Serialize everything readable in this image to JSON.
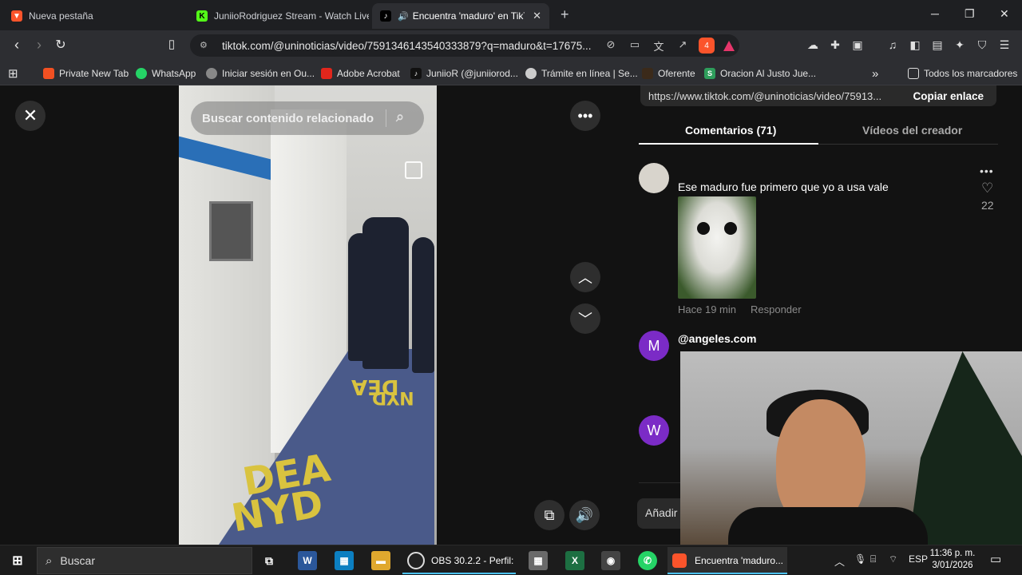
{
  "browser": {
    "tabs": [
      {
        "label": "Nueva pestaña",
        "icon": "brave-lion-icon"
      },
      {
        "label": "JuniioRodriguez Stream - Watch Live",
        "icon": "kick-icon"
      },
      {
        "label": "Encuentra 'maduro' en TikTok",
        "icon": "tiktok-icon",
        "audio": true
      }
    ],
    "window_controls": {
      "minimize": "─",
      "maximize": "❐",
      "close": "✕"
    },
    "new_tab": "+",
    "url": "tiktok.com/@uninoticias/video/7591346143540333879?q=maduro&t=17675...",
    "shields_count": "4"
  },
  "bookmarks": [
    {
      "label": "Private New Tab",
      "color": "#f25022"
    },
    {
      "label": "WhatsApp",
      "color": "#25d366"
    },
    {
      "label": "Iniciar sesión en Ou...",
      "color": "#888888"
    },
    {
      "label": "Adobe Acrobat",
      "color": "#e1261c"
    },
    {
      "label": "JuniioR (@juniiorod...",
      "color": "#111111"
    },
    {
      "label": "Trámite en línea | Se...",
      "color": "#cccccc"
    },
    {
      "label": "Oferente",
      "color": "#3b2a1a"
    },
    {
      "label": "Oracion Al Justo Jue...",
      "color": "#2e9d5b"
    }
  ],
  "bookmarks_more": "»",
  "bookmarks_all": "Todos los marcadores",
  "viewer": {
    "search_placeholder": "Buscar contenido relacionado",
    "video_text_1": "DEA",
    "video_text_2": "NYD",
    "video_text_3": "DEA",
    "video_text_4": "NYD"
  },
  "panel": {
    "share_url": "https://www.tiktok.com/@uninoticias/video/75913...",
    "copy_label": "Copiar enlace",
    "tab_comments": "Comentarios (71)",
    "tab_creator": "Vídeos del creador",
    "comments": [
      {
        "text": "Ese maduro fue primero que yo a usa vale",
        "time": "Hace 19 min",
        "reply": "Responder",
        "likes": "22"
      },
      {
        "user": "@angeles.com",
        "avatar_letter": "M",
        "avatar_color": "#7b2bc6"
      },
      {
        "avatar_letter": "W",
        "avatar_color": "#7b2bc6"
      }
    ],
    "add_comment": "Añadir"
  },
  "taskbar": {
    "search": "Buscar",
    "apps": [
      {
        "label": "OBS 30.2.2 - Perfil: ..."
      },
      {
        "label": "Encuentra 'maduro..."
      }
    ],
    "lang": "ESP",
    "time": "11:36 p. m.",
    "date": "3/01/2026"
  }
}
